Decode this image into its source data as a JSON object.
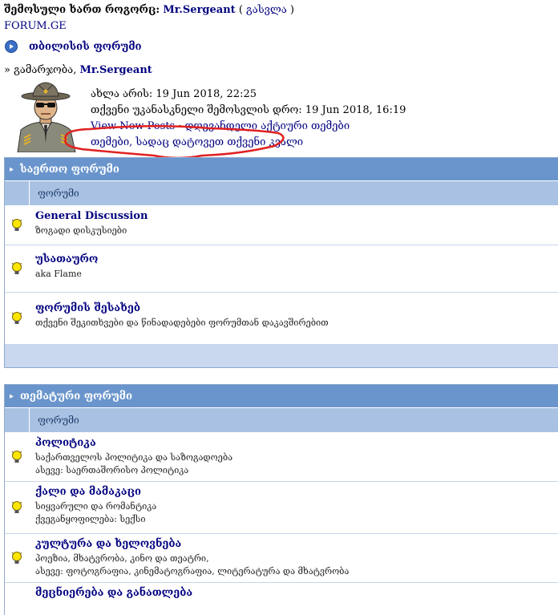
{
  "header": {
    "logged_as_label": "შემოსული ხართ როგორც:",
    "username": "Mr.Sergeant",
    "logout_open": "( ",
    "logout_label": "გასვლა",
    "logout_close": " )",
    "site_name": "FORUM.GE",
    "board_title": "თბილისის ფორუმი",
    "welcome_prefix": "» გამარჯობა, ",
    "welcome_user": "Mr.Sergeant"
  },
  "userinfo": {
    "now_label": "ახლა არის: 19 Jun 2018, 22:25",
    "last_visit_label": "თქვენი უკანასკნელი შემოსვლის დრო: 19 Jun 2018, 16:19",
    "view_new_posts": "View New Posts",
    "separator": " · ",
    "unanswered_topics": "დღევანდელი აქტიური თემები",
    "topics_with_posts": "თემები, სადაც დატოვეთ თქვენი კვალი"
  },
  "categories": [
    {
      "title": "საერთო ფორუმი",
      "column_header": "ფორუმი",
      "forums": [
        {
          "name": "General Discussion",
          "desc": [
            "ზოგადი დისკუსიები"
          ]
        },
        {
          "name": "უსათაურო",
          "desc": [
            "aka Flame"
          ]
        },
        {
          "name": "ფორუმის შესახებ",
          "desc": [
            "თქვენი შეკითხვები და წინადადებები ფორუმთან დაკავშირებით"
          ]
        }
      ]
    },
    {
      "title": "თემატური ფორუმი",
      "column_header": "ფორუმი",
      "forums": [
        {
          "name": "პოლიტიკა",
          "desc": [
            "საქართველოს პოლიტიკა და საზოგადოება",
            "ასევე: საერთაშორისო პოლიტიკა"
          ]
        },
        {
          "name": "ქალი და მამაკაცი",
          "desc": [
            "სიყვარული და რომანტიკა",
            "ქვეგანყოფილება: სექსი"
          ]
        },
        {
          "name": "კულტურა და ხელოვნება",
          "desc": [
            "პოეზია, მხატვრობა, კინო და თეატრი,",
            "ასევე: ფოტოგრაფია, კინემატოგრაფია, ლიტერატურა და მხატვრობა"
          ]
        },
        {
          "name": "მეცნიერება და განათლება",
          "desc": []
        }
      ]
    }
  ],
  "colors": {
    "link": "#000080",
    "category_header": "#6a95cc",
    "column_header": "#a9c2e3",
    "annotation": "#e02020"
  },
  "icons": {
    "nav": "play-circle-icon",
    "forum": "lightbulb-icon",
    "category": "chevron-right-icon"
  }
}
